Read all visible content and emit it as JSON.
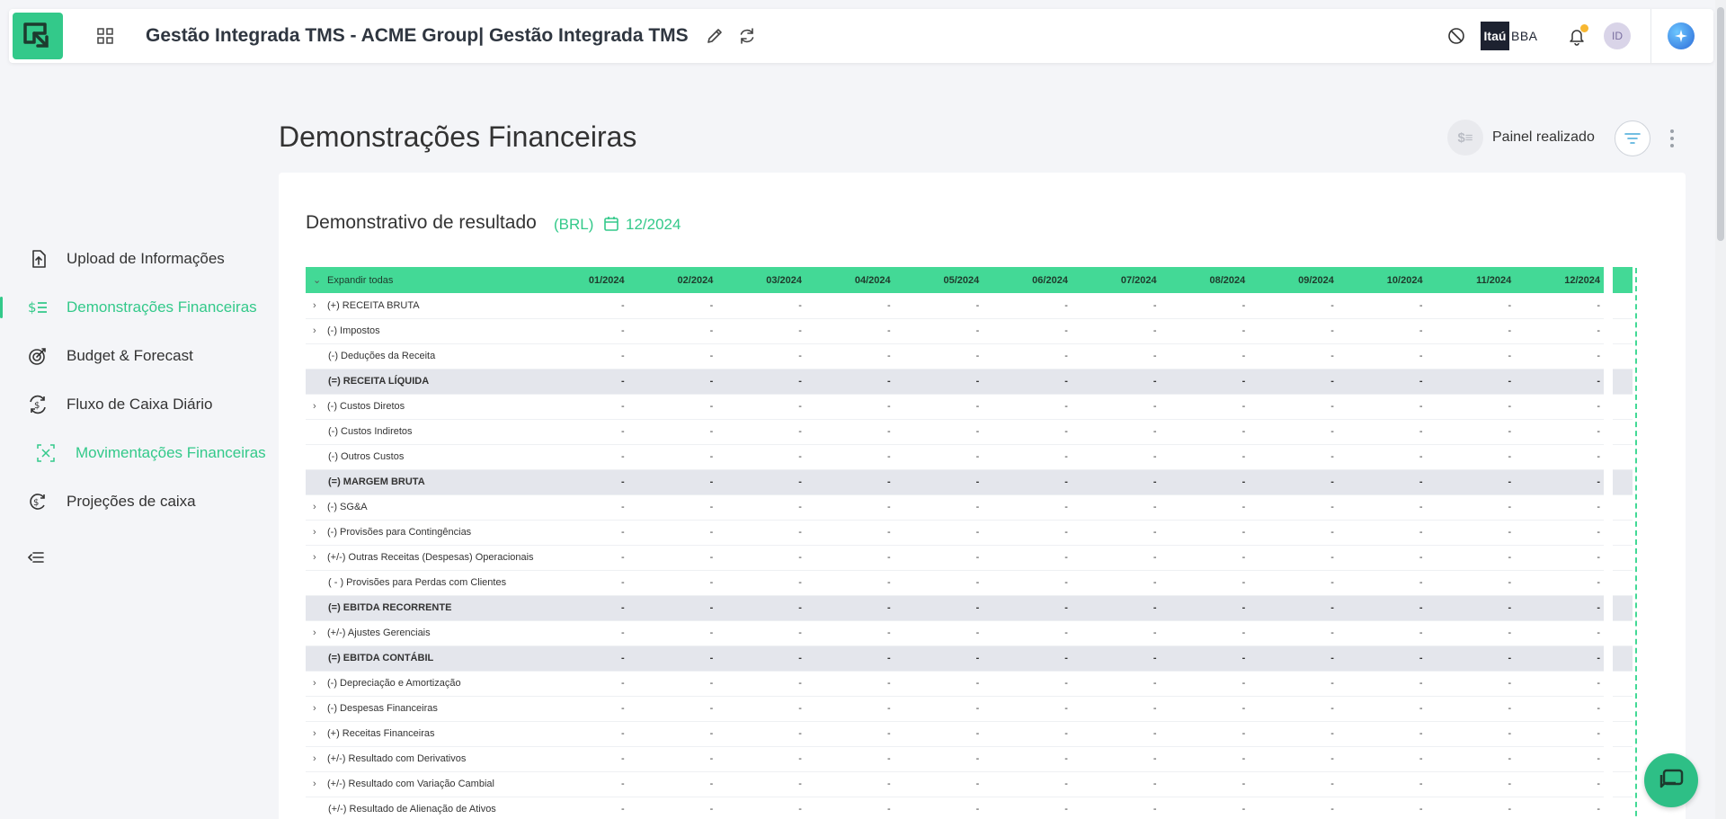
{
  "header": {
    "app_title": "Gestão Integrada TMS - ACME Group| Gestão Integrada TMS",
    "partner_logo_box": "Itaú",
    "partner_logo_text": "BBA",
    "avatar_initials": "ID"
  },
  "sidebar": {
    "items": [
      {
        "label": "Upload de Informações",
        "icon": "upload-file-icon"
      },
      {
        "label": "Demonstrações Financeiras",
        "icon": "dollar-list-icon",
        "active": true
      },
      {
        "label": "Budget & Forecast",
        "icon": "target-icon"
      },
      {
        "label": "Fluxo de Caixa Diário",
        "icon": "cash-flow-icon"
      },
      {
        "label": "Movimentações Financeiras",
        "icon": "transfer-icon",
        "sub": true
      },
      {
        "label": "Projeções de caixa",
        "icon": "cash-projection-icon"
      }
    ]
  },
  "main": {
    "page_title": "Demonstrações Financeiras",
    "painel_icon_text": "$≡",
    "painel_label": "Painel realizado",
    "card": {
      "title": "Demonstrativo de resultado",
      "currency": "(BRL)",
      "period": "12/2024"
    },
    "table": {
      "expand_all": "Expandir todas",
      "months": [
        "01/2024",
        "02/2024",
        "03/2024",
        "04/2024",
        "05/2024",
        "06/2024",
        "07/2024",
        "08/2024",
        "09/2024",
        "10/2024",
        "11/2024",
        "12/2024"
      ],
      "empty_value": "-",
      "rows": [
        {
          "label": "(+) RECEITA BRUTA",
          "type": "expandable"
        },
        {
          "label": "(-) Impostos",
          "type": "expandable"
        },
        {
          "label": "(-) Deduções da Receita",
          "type": "leaf"
        },
        {
          "label": "(=) RECEITA LÍQUIDA",
          "type": "total"
        },
        {
          "label": "(-) Custos Diretos",
          "type": "expandable"
        },
        {
          "label": "(-) Custos Indiretos",
          "type": "leaf"
        },
        {
          "label": "(-) Outros Custos",
          "type": "leaf"
        },
        {
          "label": "(=) MARGEM BRUTA",
          "type": "total"
        },
        {
          "label": "(-) SG&A",
          "type": "expandable"
        },
        {
          "label": "(-) Provisões para Contingências",
          "type": "expandable"
        },
        {
          "label": "(+/-) Outras Receitas (Despesas) Operacionais",
          "type": "expandable"
        },
        {
          "label": "( - ) Provisões para Perdas com Clientes",
          "type": "leaf"
        },
        {
          "label": "(=) EBITDA RECORRENTE",
          "type": "total"
        },
        {
          "label": "(+/-) Ajustes Gerenciais",
          "type": "expandable"
        },
        {
          "label": "(=) EBITDA CONTÁBIL",
          "type": "total"
        },
        {
          "label": "(-) Depreciação e Amortização",
          "type": "expandable"
        },
        {
          "label": "(-) Despesas Financeiras",
          "type": "expandable"
        },
        {
          "label": "(+) Receitas Financeiras",
          "type": "expandable"
        },
        {
          "label": "(+/-) Resultado com Derivativos",
          "type": "expandable"
        },
        {
          "label": "(+/-) Resultado com Variação Cambial",
          "type": "expandable"
        },
        {
          "label": "(+/-) Resultado de Alienação de Ativos",
          "type": "leaf"
        }
      ]
    }
  },
  "colors": {
    "accent": "#33c98a",
    "table_header": "#43d996",
    "total_row": "#e4e6ec"
  }
}
